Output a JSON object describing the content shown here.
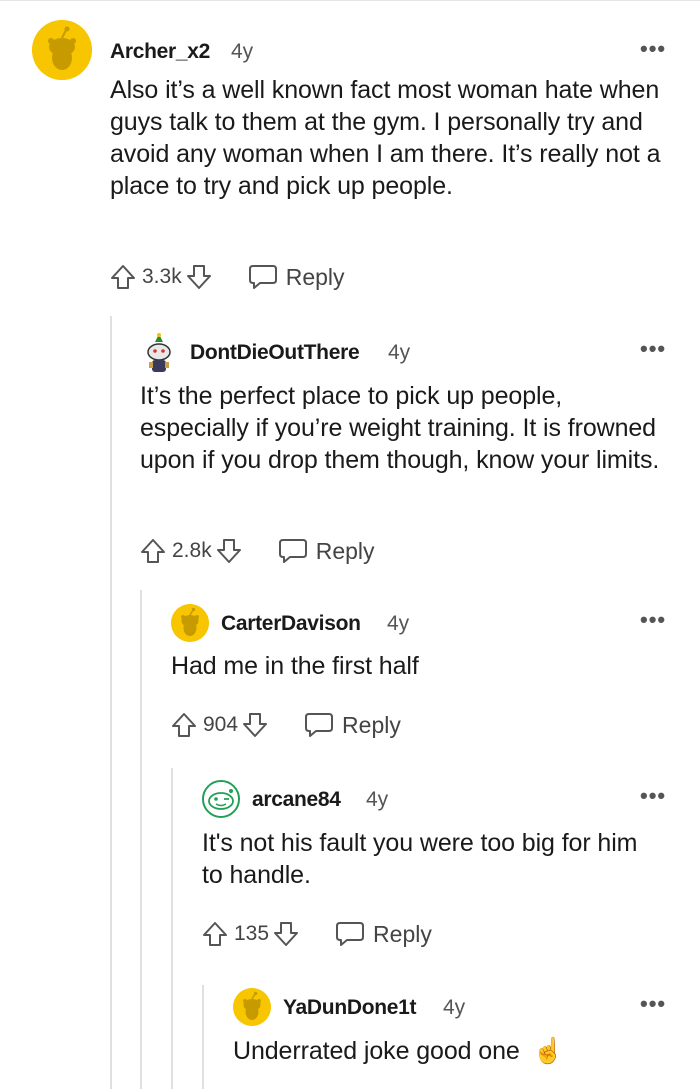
{
  "comments": [
    {
      "username": "Archer_x2",
      "age": "4y",
      "body": "Also it’s a well known fact most woman hate when guys talk to them at the gym. I personally try and avoid any woman when I am there. It’s really not a place to try and pick up people.",
      "score": "3.3k",
      "reply_label": "Reply",
      "more": "•••"
    },
    {
      "username": "DontDieOutThere",
      "age": "4y",
      "body": "It’s the perfect place to pick up people, especially if you’re weight training. It is frowned upon if you drop them though, know your limits.",
      "score": "2.8k",
      "reply_label": "Reply",
      "more": "•••"
    },
    {
      "username": "CarterDavison",
      "age": "4y",
      "body": "Had me in the first half",
      "score": "904",
      "reply_label": "Reply",
      "more": "•••"
    },
    {
      "username": "arcane84",
      "age": "4y",
      "body": "It's not his fault you were too big for him to handle.",
      "score": "135",
      "reply_label": "Reply",
      "more": "•••"
    },
    {
      "username": "YaDunDone1t",
      "age": "4y",
      "body": "Underrated joke good one",
      "emoji": "☝",
      "more": "•••"
    }
  ]
}
